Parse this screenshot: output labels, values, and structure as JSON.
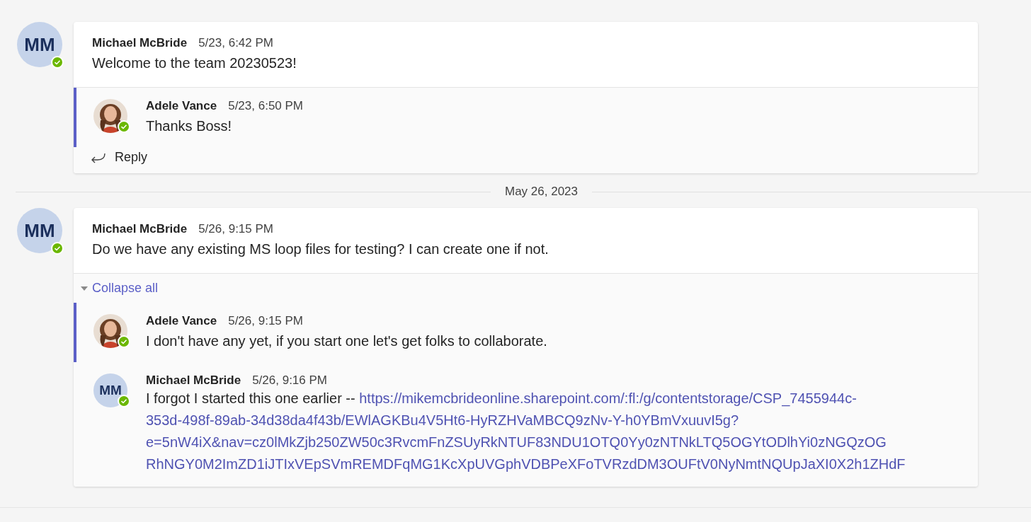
{
  "feed": [
    {
      "kind": "thread",
      "avatar": {
        "kind": "initials",
        "initials": "MM"
      },
      "online": true,
      "author": "Michael McBride",
      "time": "5/23, 6:42 PM",
      "text": "Welcome to the team 20230523!",
      "replies": [
        {
          "online": true,
          "author": "Adele Vance",
          "time": "5/23, 6:50 PM",
          "text": "Thanks Boss!",
          "highlighted": true
        }
      ],
      "reply_label": "Reply"
    },
    {
      "kind": "date",
      "label": "May 26, 2023"
    },
    {
      "kind": "thread",
      "avatar": {
        "kind": "initials",
        "initials": "MM"
      },
      "online": true,
      "author": "Michael McBride",
      "time": "5/26, 9:15 PM",
      "text": "Do we have any existing MS loop files for testing? I can create one if not.",
      "collapse_label": "Collapse all",
      "replies": [
        {
          "online": true,
          "author": "Adele Vance",
          "time": "5/26, 9:15 PM",
          "text": "I don't have any yet, if you start one let's get folks to collaborate.",
          "highlighted": true
        },
        {
          "avatar": {
            "kind": "initials",
            "initials": "MM"
          },
          "online": true,
          "author": "Michael McBride",
          "time": "5/26, 9:16 PM",
          "text": "I forgot I started this one earlier -- ",
          "highlighted": false,
          "link_lines": [
            "https://mikemcbrideonline.sharepoint.com/:fl:/g/contentstorage/CSP_7455944c-",
            "353d-498f-89ab-34d38da4f43b/EWlAGKBu4V5Ht6-HyRZHVaMBCQ9zNv-Y-h0YBmVxuuvI5g?",
            "e=5nW4iX&nav=cz0lMkZjb250ZW50c3RvcmFnZSUyRkNTUF83NDU1OTQ0Yy0zNTNkLTQ5OGYtODlhYi0zNGQzOG",
            "RhNGY0M2ImZD1iJTIxVEpSVmREMDFqMG1KcXpUVGphVDBPeXFoTVRzdDM3OUFtV0NyNmtNQUpJaXI0X2h1ZHdF"
          ]
        }
      ]
    }
  ]
}
